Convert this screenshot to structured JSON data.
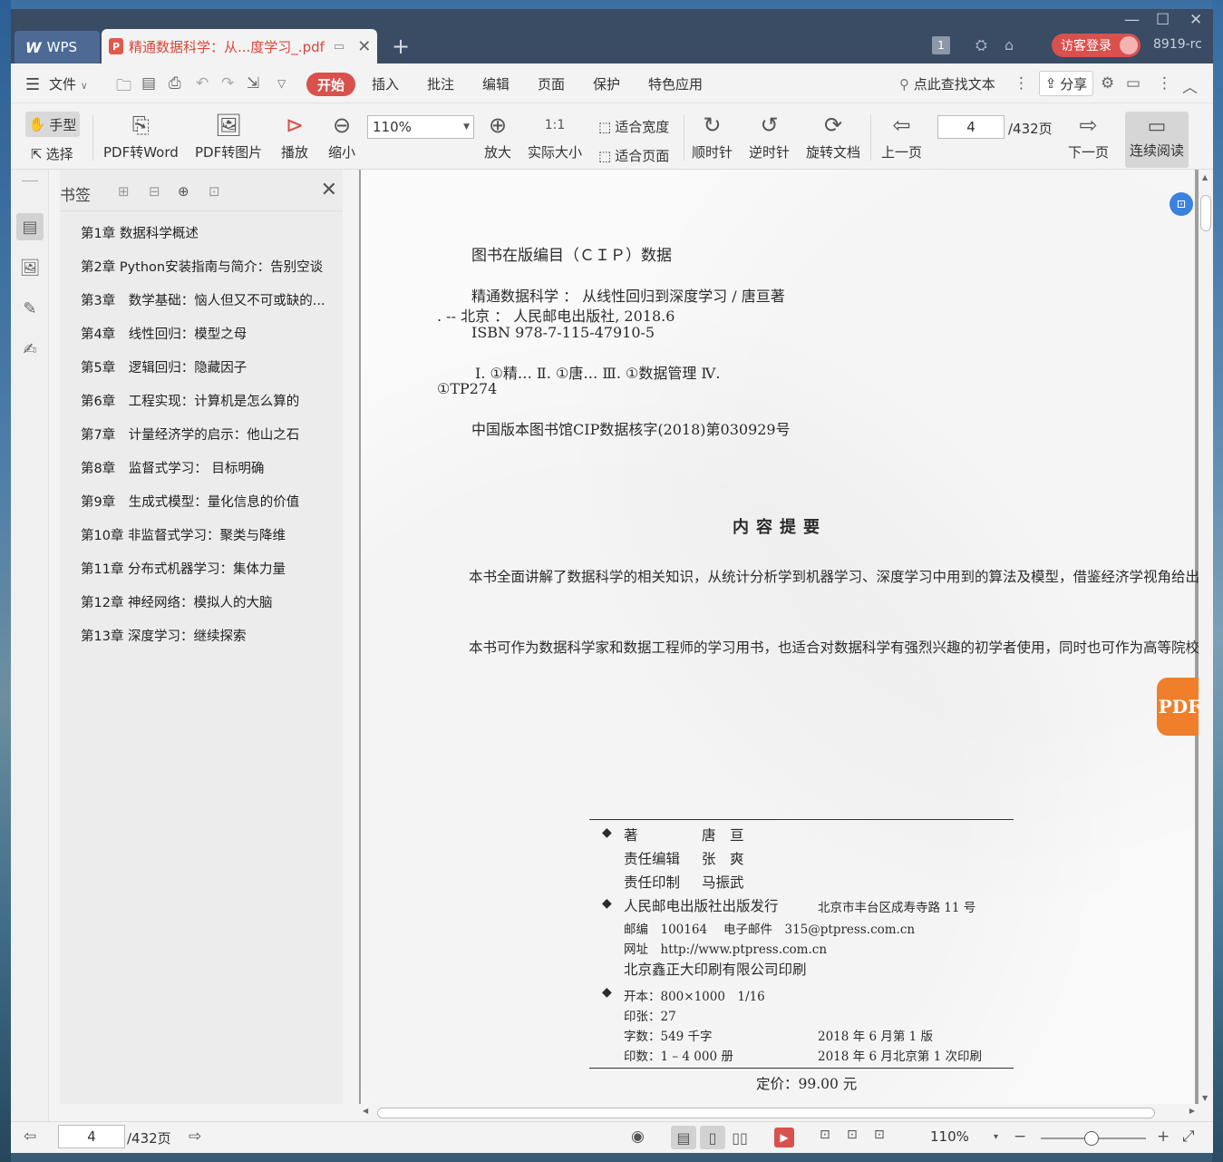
{
  "app": {
    "logo_text": "WPS",
    "doc_tab_title": "精通数据科学：从...度学习_.pdf",
    "version": "8919-rc",
    "page_badge": "1",
    "login_label": "访客登录"
  },
  "menu": {
    "file": "文件",
    "tabs": [
      "开始",
      "插入",
      "批注",
      "编辑",
      "页面",
      "保护",
      "特色应用"
    ],
    "search": "点此查找文本",
    "share": "分享"
  },
  "toolbar": {
    "hand": "手型",
    "select": "选择",
    "pdf_to_word": "PDF转Word",
    "pdf_to_image": "PDF转图片",
    "play": "播放",
    "zoom_out": "缩小",
    "zoom_value": "110%",
    "zoom_in": "放大",
    "actual_size": "实际大小",
    "fit_width": "适合宽度",
    "fit_page": "适合页面",
    "clockwise": "顺时针",
    "counter_clockwise": "逆时针",
    "rotate_doc": "旋转文档",
    "prev_page": "上一页",
    "page_current": "4",
    "page_total": "/432页",
    "next_page": "下一页",
    "continuous": "连续阅读"
  },
  "bookmarks": {
    "title": "书签",
    "items": [
      "第1章 数据科学概述",
      "第2章 Python安装指南与简介：告别空谈",
      "第3章　数学基础：恼人但又不可或缺的...",
      "第4章　线性回归：模型之母",
      "第5章　逻辑回归：隐藏因子",
      "第6章　工程实现：计算机是怎么算的",
      "第7章　计量经济学的启示：他山之石",
      "第8章　监督式学习： 目标明确",
      "第9章　生成式模型：量化信息的价值",
      "第10章 非监督式学习：聚类与降维",
      "第11章 分布式机器学习：集体力量",
      "第12章 神经网络：模拟人的大脑",
      "第13章 深度学习：继续探索"
    ]
  },
  "document": {
    "cip_title": "图书在版编目（ＣＩＰ）数据",
    "cip_line1": "精通数据科学 ： 从线性回归到深度学习 / 唐亘著",
    "cip_line2": ". -- 北京 ： 人民邮电出版社, 2018.6",
    "cip_line3": "ISBN 978-7-115-47910-5",
    "cip_line4": "Ⅰ. ①精… Ⅱ. ①唐… Ⅲ. ①数据管理 Ⅳ.",
    "cip_line5": "①TP274",
    "cip_line6": "中国版本图书馆CIP数据核字(2018)第030929号",
    "summary_title": "内容提要",
    "summary_p1": "本书全面讲解了数据科学的相关知识，从统计分析学到机器学习、深度学习中用到的算法及模型，借鉴经济学视角给出模型的相关解释，深入探讨模型的可用性，并结合大量的实际案例和代码帮助读者学以致用，将具体的应用场景和现有的模型相结合，从而更好地发现模型的潜在应用场景。",
    "summary_p2": "本书可作为数据科学家和数据工程师的学习用书，也适合对数据科学有强烈兴趣的初学者使用，同时也可作为高等院校计算机、数学及相关专业的师生用书和培训学校的教材。",
    "imprint": {
      "author_label": "著",
      "author": "唐　亘",
      "editor_label": "责任编辑",
      "editor": "张　爽",
      "printer_label": "责任印制",
      "printer": "马振武",
      "publisher": "人民邮电出版社出版发行",
      "address": "北京市丰台区成寿寺路 11 号",
      "postcode": "邮编　100164",
      "email": "电子邮件　315@ptpress.com.cn",
      "website": "网址　http://www.ptpress.com.cn",
      "print_house": "北京鑫正大印刷有限公司印刷",
      "format": "开本：800×1000　1/16",
      "sheets": "印张：27",
      "words": "字数：549 千字",
      "edition": "2018 年 6 月第 1 版",
      "copies": "印数：1 – 4 000 册",
      "printing": "2018 年 6 月北京第 1 次印刷",
      "price": "定价：99.00 元"
    }
  },
  "statusbar": {
    "page_current": "4",
    "page_total": "/432页",
    "zoom": "110%"
  },
  "colors": {
    "accent_red": "#d9504d",
    "titlebar": "#3a4b64",
    "pdf_orange": "#f07f2c"
  }
}
